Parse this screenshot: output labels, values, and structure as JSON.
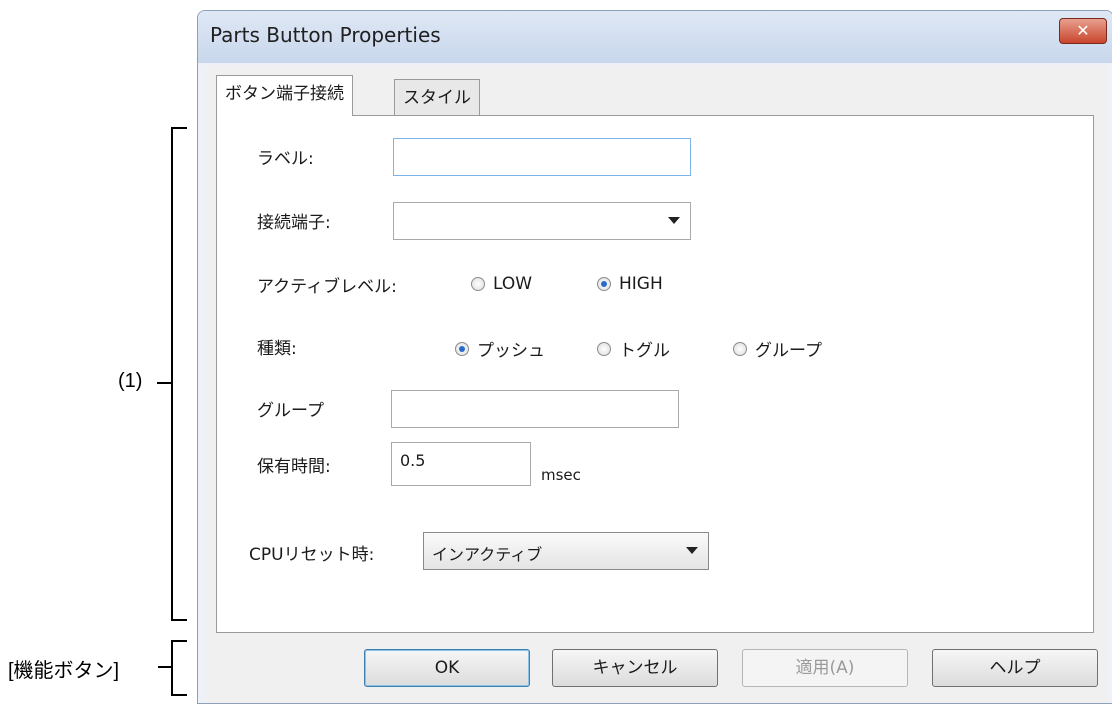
{
  "annotations": {
    "section_1": "(1)",
    "function_buttons": "[機能ボタン]"
  },
  "window": {
    "title": "Parts Button Properties",
    "close_glyph": "✕"
  },
  "tabs": [
    {
      "label": "ボタン端子接続",
      "active": true
    },
    {
      "label": "スタイル",
      "active": false
    }
  ],
  "form": {
    "label_field": {
      "label": "ラベル:",
      "value": ""
    },
    "terminal_field": {
      "label": "接続端子:",
      "value": ""
    },
    "active_level": {
      "label": "アクティブレベル:",
      "options": [
        {
          "label": "LOW",
          "selected": false
        },
        {
          "label": "HIGH",
          "selected": true
        }
      ]
    },
    "type": {
      "label": "種類:",
      "options": [
        {
          "label": "プッシュ",
          "selected": true
        },
        {
          "label": "トグル",
          "selected": false
        },
        {
          "label": "グループ",
          "selected": false
        }
      ]
    },
    "group_field": {
      "label": "グループ",
      "value": ""
    },
    "hold_time": {
      "label": "保有時間:",
      "value": "0.5",
      "unit": "msec"
    },
    "cpu_reset": {
      "label": "CPUリセット時:",
      "value": "インアクティブ"
    }
  },
  "buttons": {
    "ok": "OK",
    "cancel": "キャンセル",
    "apply": "適用(A)",
    "help": "ヘルプ"
  }
}
